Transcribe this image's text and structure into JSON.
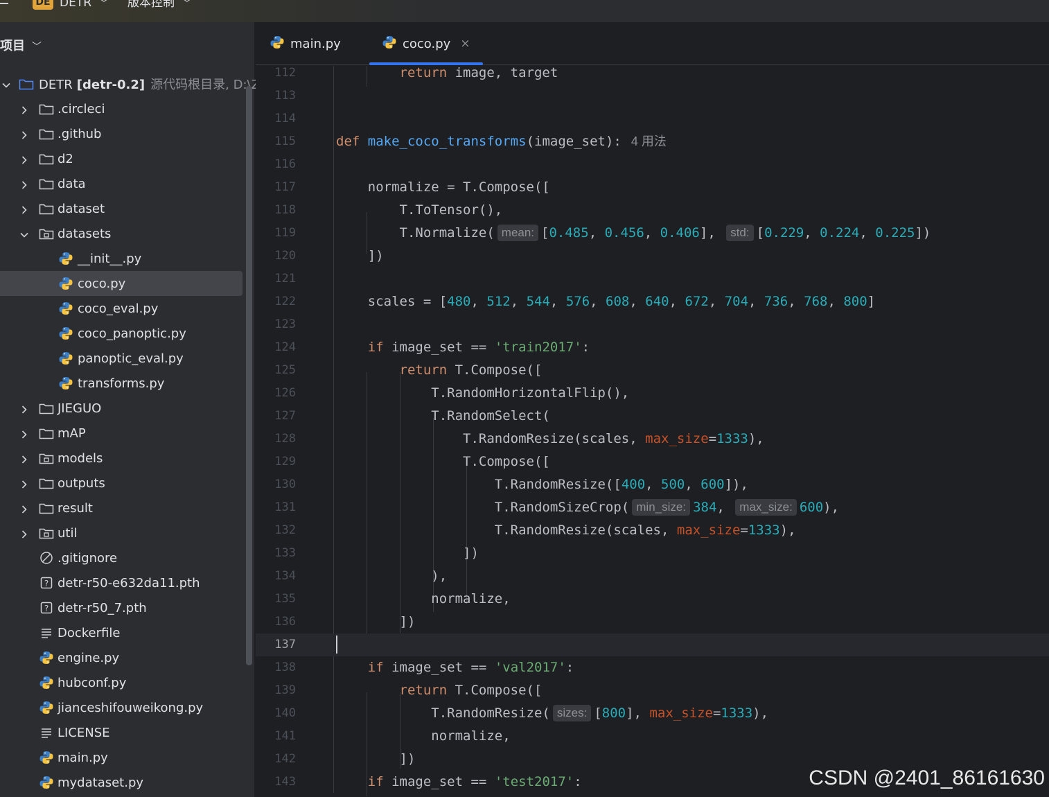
{
  "titlebar": {
    "project_badge": "DE",
    "project_name": "DETR",
    "vcs_menu": "版本控制"
  },
  "sidebar": {
    "header": "项目",
    "root": {
      "name": "DETR",
      "branch": "[detr-0.2]",
      "hint": "源代码根目录, D:\\ZZ"
    },
    "items": [
      {
        "label": ".circleci",
        "type": "folder"
      },
      {
        "label": ".github",
        "type": "folder"
      },
      {
        "label": "d2",
        "type": "folder"
      },
      {
        "label": "data",
        "type": "folder"
      },
      {
        "label": "dataset",
        "type": "folder"
      },
      {
        "label": "datasets",
        "type": "package"
      },
      {
        "label": "__init__.py",
        "type": "python"
      },
      {
        "label": "coco.py",
        "type": "python"
      },
      {
        "label": "coco_eval.py",
        "type": "python"
      },
      {
        "label": "coco_panoptic.py",
        "type": "python"
      },
      {
        "label": "panoptic_eval.py",
        "type": "python"
      },
      {
        "label": "transforms.py",
        "type": "python"
      },
      {
        "label": "JIEGUO",
        "type": "folder"
      },
      {
        "label": "mAP",
        "type": "folder"
      },
      {
        "label": "models",
        "type": "package"
      },
      {
        "label": "outputs",
        "type": "folder"
      },
      {
        "label": "result",
        "type": "folder"
      },
      {
        "label": "util",
        "type": "package"
      },
      {
        "label": ".gitignore",
        "type": "ignore"
      },
      {
        "label": "detr-r50-e632da11.pth",
        "type": "unknown"
      },
      {
        "label": "detr-r50_7.pth",
        "type": "unknown"
      },
      {
        "label": "Dockerfile",
        "type": "text"
      },
      {
        "label": "engine.py",
        "type": "python"
      },
      {
        "label": "hubconf.py",
        "type": "python"
      },
      {
        "label": "jianceshifouweikong.py",
        "type": "python"
      },
      {
        "label": "LICENSE",
        "type": "text"
      },
      {
        "label": "main.py",
        "type": "python"
      },
      {
        "label": "mydataset.py",
        "type": "python"
      }
    ]
  },
  "tabs": [
    {
      "label": "main.py",
      "active": false
    },
    {
      "label": "coco.py",
      "active": true,
      "close": "×"
    }
  ],
  "editor": {
    "line_numbers": [
      "112",
      "113",
      "114",
      "115",
      "116",
      "117",
      "118",
      "119",
      "120",
      "121",
      "122",
      "123",
      "124",
      "125",
      "126",
      "127",
      "128",
      "129",
      "130",
      "131",
      "132",
      "133",
      "134",
      "135",
      "136",
      "137",
      "138",
      "139",
      "140",
      "141",
      "142",
      "143"
    ],
    "current_line": "137",
    "usage_hint": "4 用法",
    "hints": {
      "mean": "mean:",
      "std": "std:",
      "min_size": "min_size:",
      "max_size": "max_size:",
      "sizes": "sizes:"
    },
    "tokens": {
      "return": "return",
      "def": "def",
      "if": "if",
      "image_target": " image, target",
      "fn_name": "make_coco_transforms",
      "fn_args": "(image_set):",
      "normalize_assign": "normalize = T.Compose([",
      "to_tensor": "T.ToTensor(),",
      "t_normalize": "T.Normalize(",
      "mean_vals": [
        "0.485",
        "0.456",
        "0.406"
      ],
      "std_vals": [
        "0.229",
        "0.224",
        "0.225"
      ],
      "close_list": "])",
      "scales_assign": "scales = [",
      "scales": [
        "480",
        "512",
        "544",
        "576",
        "608",
        "640",
        "672",
        "704",
        "736",
        "768",
        "800"
      ],
      "image_set_eq": " image_set == ",
      "train": "'train2017'",
      "val": "'val2017'",
      "test": "'test2017'",
      "compose": " T.Compose([",
      "t_compose": "T.Compose([",
      "hflip": "T.RandomHorizontalFlip(),",
      "rselect": "T.RandomSelect(",
      "rresize_scales": "T.RandomResize(scales, ",
      "max_size_kw": "max_size",
      "max_size_val": "1333",
      "rresize_open": "T.RandomResize([",
      "resize_vals": [
        "400",
        "500",
        "600"
      ],
      "sizecrop": "T.RandomSizeCrop(",
      "crop_min": "384",
      "crop_max": "600",
      "rresize_call": "T.RandomResize(",
      "val_size": "800",
      "close_paren_comma": "),",
      "normalize_comma": "normalize,",
      "close_inner": "])"
    }
  },
  "watermark": "CSDN @2401_86161630"
}
